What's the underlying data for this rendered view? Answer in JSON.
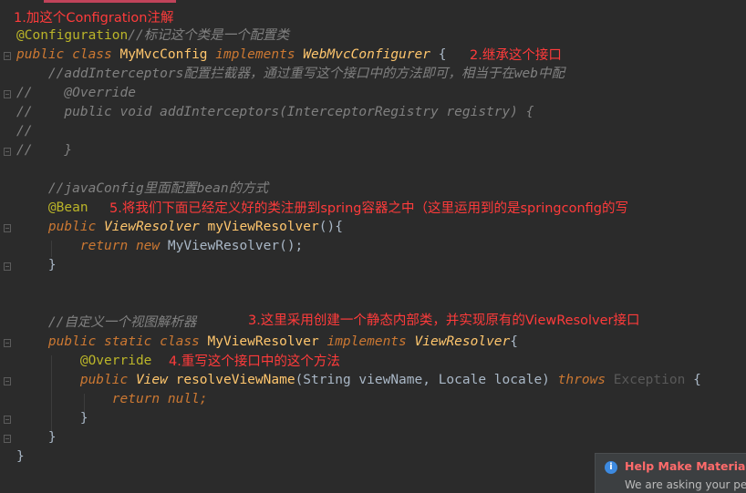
{
  "editor": {
    "lines": [
      [],
      [
        {
          "t": "@Configuration",
          "c": "ann"
        },
        {
          "t": "//标记这个类是一个配置类",
          "c": "cmt"
        }
      ],
      [
        {
          "t": "public class ",
          "c": "kw"
        },
        {
          "t": "MyMvcConfig ",
          "c": "cls"
        },
        {
          "t": "implements ",
          "c": "kw"
        },
        {
          "t": "WebMvcConfigurer",
          "c": "iface"
        },
        {
          "t": " {",
          "c": "plain"
        }
      ],
      [
        {
          "t": "    //addInterceptors配置拦截器，通过重写这个接口中的方法即可，相当于在web中配",
          "c": "cmt"
        }
      ],
      [
        {
          "t": "//    @Override",
          "c": "cmt"
        }
      ],
      [
        {
          "t": "//    public void addInterceptors(InterceptorRegistry registry) {",
          "c": "cmt"
        }
      ],
      [
        {
          "t": "//",
          "c": "cmt"
        }
      ],
      [
        {
          "t": "//    }",
          "c": "cmt"
        }
      ],
      [],
      [
        {
          "t": "    //javaConfig里面配置bean的方式",
          "c": "cmt"
        }
      ],
      [
        {
          "t": "    @Bean",
          "c": "ann"
        }
      ],
      [
        {
          "t": "    public ",
          "c": "kw"
        },
        {
          "t": "ViewResolver ",
          "c": "iface"
        },
        {
          "t": "myViewResolver",
          "c": "cls"
        },
        {
          "t": "(){",
          "c": "plain"
        }
      ],
      [
        {
          "t": "        return new ",
          "c": "kw"
        },
        {
          "t": "MyViewResolver",
          "c": "plain"
        },
        {
          "t": "();",
          "c": "plain"
        }
      ],
      [
        {
          "t": "    }",
          "c": "plain"
        }
      ],
      [],
      [],
      [
        {
          "t": "    //自定义一个视图解析器",
          "c": "cmt"
        }
      ],
      [
        {
          "t": "    public static class ",
          "c": "kw"
        },
        {
          "t": "MyViewResolver ",
          "c": "cls"
        },
        {
          "t": "implements ",
          "c": "kw"
        },
        {
          "t": "ViewResolver",
          "c": "iface"
        },
        {
          "t": "{",
          "c": "plain"
        }
      ],
      [
        {
          "t": "        @Override",
          "c": "ann"
        }
      ],
      [
        {
          "t": "        public ",
          "c": "kw"
        },
        {
          "t": "View ",
          "c": "iface"
        },
        {
          "t": "resolveViewName",
          "c": "cls"
        },
        {
          "t": "(String viewName, Locale locale) ",
          "c": "plain"
        },
        {
          "t": "throws ",
          "c": "kw"
        },
        {
          "t": "Exception",
          "c": "dim"
        },
        {
          "t": " {",
          "c": "plain"
        }
      ],
      [
        {
          "t": "            return null",
          "c": "kw"
        },
        {
          "t": ";",
          "c": "kw"
        }
      ],
      [
        {
          "t": "        }",
          "c": "plain"
        }
      ],
      [
        {
          "t": "    }",
          "c": "plain"
        }
      ],
      [
        {
          "t": "}",
          "c": "plain"
        }
      ]
    ]
  },
  "annotations": [
    "1.加这个Configration注解",
    "2.继承这个接口",
    "5.将我们下面已经定义好的类注册到spring容器之中（这里运用到的是springconfig的写",
    "3.这里采用创建一个静态内部类，并实现原有的ViewResolver接口",
    "4.重写这个接口中的这个方法"
  ],
  "popup": {
    "icon": "i",
    "title": "Help Make Material T",
    "body": "We are asking your pe"
  }
}
